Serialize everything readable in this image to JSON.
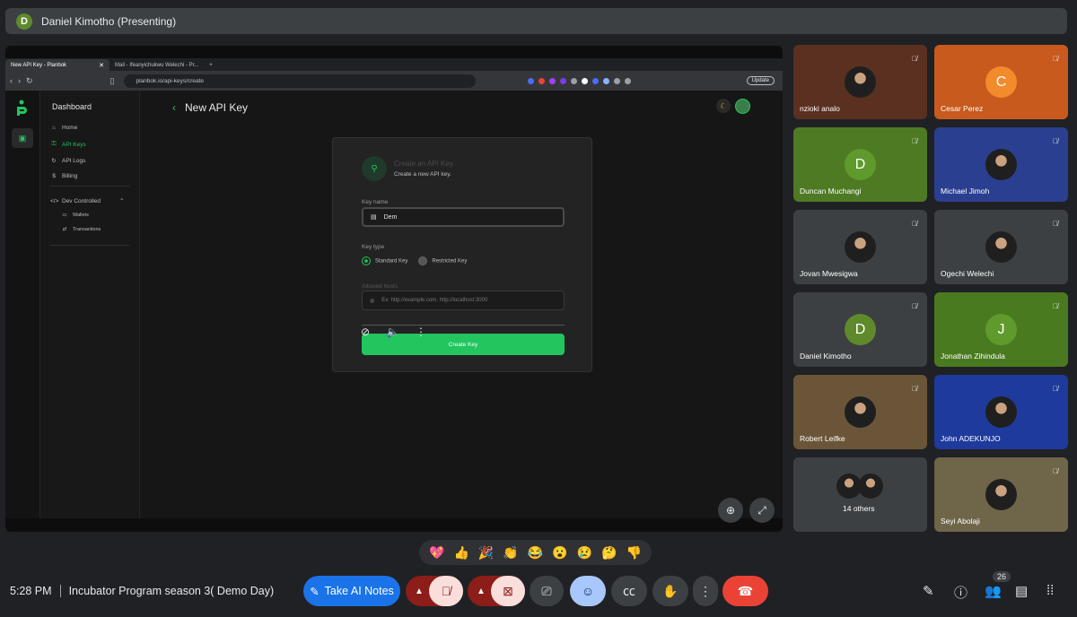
{
  "presenter": {
    "initial": "D",
    "label": "Daniel Kimotho (Presenting)"
  },
  "browser": {
    "tabs": [
      {
        "title": "New API Key - Planbok",
        "close": "✕"
      },
      {
        "title": "Mail - Ifeanyichukwu Welechi - Pr..."
      }
    ],
    "new_tab": "+",
    "url": "planbok.io/api-keys/create",
    "update_label": "Update"
  },
  "app": {
    "sidebar_title": "Dashboard",
    "nav": [
      {
        "label": "Home",
        "icon": "⌂"
      },
      {
        "label": "API Keys",
        "icon": "⚿"
      },
      {
        "label": "API Logs",
        "icon": "↻"
      },
      {
        "label": "Billing",
        "icon": "$"
      },
      {
        "label": "Dev Controlled",
        "icon": "</>"
      },
      {
        "label": "Wallets",
        "icon": "▭"
      },
      {
        "label": "Transactions",
        "icon": "⇄"
      }
    ],
    "page_title": "New API Key",
    "dialog": {
      "title": "Create an API Key",
      "subtitle": "Create a new API key.",
      "key_name_label": "Key name",
      "key_name_value": "Dem",
      "key_type_label": "Key type",
      "standard": "Standard Key",
      "restricted": "Restricted Key",
      "origins_label": "Allowed hosts",
      "origins_placeholder": "Ex: http://example.com, http://localhost:3000",
      "create_label": "Create Key"
    }
  },
  "participants": [
    {
      "name": "nzioki analo",
      "initial": "",
      "bg": "#5a3020",
      "av": "photo"
    },
    {
      "name": "Cesar Perez",
      "initial": "C",
      "bg": "#c85a1e",
      "av": "#f28b2c"
    },
    {
      "name": "Duncan Muchangi",
      "initial": "D",
      "bg": "#4e7a24",
      "av": "#5f9a2c"
    },
    {
      "name": "Michael Jimoh",
      "initial": "",
      "bg": "#2a3f8f",
      "av": "photo"
    },
    {
      "name": "Jovan Mwesigwa",
      "initial": "",
      "bg": "#3c4043",
      "av": "photo"
    },
    {
      "name": "Ogechi Welechi",
      "initial": "",
      "bg": "#3c4043",
      "av": "photo"
    },
    {
      "name": "Daniel Kimotho",
      "initial": "D",
      "bg": "#3c4043",
      "av": "#5f8a2c"
    },
    {
      "name": "Jonathan Zihindula",
      "initial": "J",
      "bg": "#4a7a20",
      "av": "#5f9a2c"
    },
    {
      "name": "Robert Leifke",
      "initial": "",
      "bg": "#6b5538",
      "av": "photo"
    },
    {
      "name": "John ADEKUNJO",
      "initial": "",
      "bg": "#1e3a9c",
      "av": "photo"
    },
    {
      "name": "14 others",
      "initial": "",
      "bg": "#3c4043",
      "av": "group"
    },
    {
      "name": "Seyi Abolaji",
      "initial": "",
      "bg": "#6f6548",
      "av": "photo"
    }
  ],
  "reactions": [
    "💖",
    "👍",
    "🎉",
    "👏",
    "😂",
    "😮",
    "😢",
    "🤔",
    "👎"
  ],
  "bottom": {
    "time": "5:28 PM",
    "meeting_title": "Incubator Program season 3( Demo Day)",
    "ai_notes": "Take AI Notes",
    "people_count": "26"
  },
  "colors": {
    "accent": "#22c55e",
    "meet_blue": "#1a73e8",
    "hangup": "#ea4335"
  }
}
